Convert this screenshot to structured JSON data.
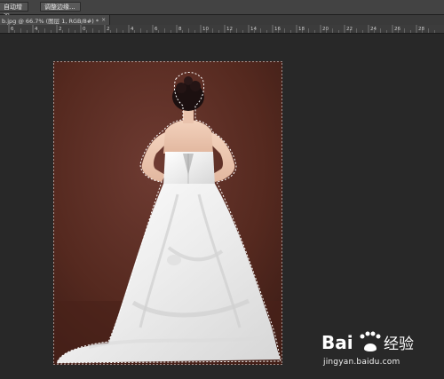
{
  "options_bar": {
    "auto_enhance_label": "自动增强",
    "refine_edge_label": "调整边缘..."
  },
  "document_tab": {
    "label": "b.jpg @ 66.7% (图层 1, RGB/8#) *",
    "close_glyph": "×"
  },
  "ruler": {
    "labels": [
      "6",
      "4",
      "2",
      "0",
      "2",
      "4",
      "6",
      "8",
      "10",
      "12",
      "14",
      "16",
      "18",
      "20",
      "22",
      "24",
      "26",
      "28"
    ]
  },
  "watermark": {
    "logo_text": "Bai 经验",
    "url": "jingyan.baidu.com"
  },
  "colors": {
    "app_bg": "#282828",
    "panel_bg": "#434343",
    "photo_backdrop": "#5a2e27",
    "dress": "#f0f0f0",
    "selection": "#ffffff"
  }
}
